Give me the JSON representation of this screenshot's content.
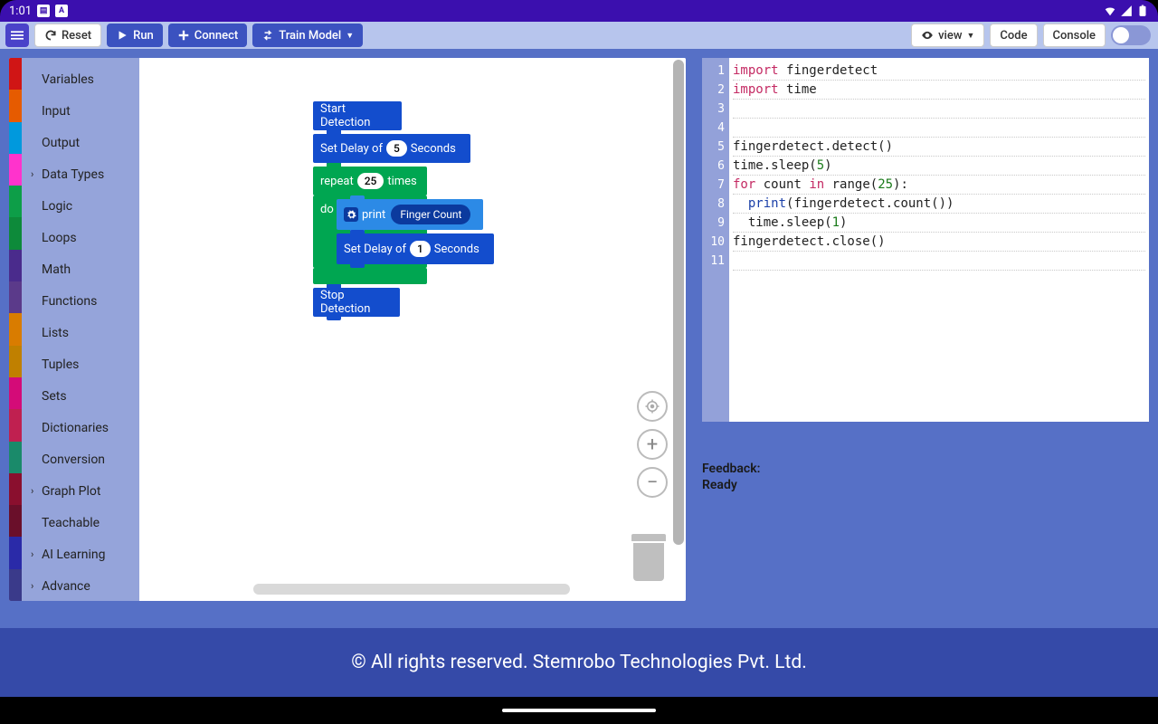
{
  "status": {
    "time": "1:01"
  },
  "toolbar": {
    "reset": "Reset",
    "run": "Run",
    "connect": "Connect",
    "train": "Train Model",
    "view": "view",
    "code": "Code",
    "console": "Console"
  },
  "categories": [
    {
      "label": "Variables",
      "expand": false,
      "color": "#d01515"
    },
    {
      "label": "Input",
      "expand": false,
      "color": "#e65b00"
    },
    {
      "label": "Output",
      "expand": false,
      "color": "#0099dd"
    },
    {
      "label": "Data Types",
      "expand": true,
      "color": "#ff33cc"
    },
    {
      "label": "Logic",
      "expand": false,
      "color": "#0d9e48"
    },
    {
      "label": "Loops",
      "expand": false,
      "color": "#0d8a3a"
    },
    {
      "label": "Math",
      "expand": false,
      "color": "#4a2b8c"
    },
    {
      "label": "Functions",
      "expand": false,
      "color": "#5b3a8a"
    },
    {
      "label": "Lists",
      "expand": false,
      "color": "#d97c00"
    },
    {
      "label": "Tuples",
      "expand": false,
      "color": "#c08000"
    },
    {
      "label": "Sets",
      "expand": false,
      "color": "#d40b78"
    },
    {
      "label": "Dictionaries",
      "expand": false,
      "color": "#c02050"
    },
    {
      "label": "Conversion",
      "expand": false,
      "color": "#1a8a6a"
    },
    {
      "label": "Graph Plot",
      "expand": true,
      "color": "#8a0f2e"
    },
    {
      "label": "Teachable",
      "expand": false,
      "color": "#6a0f2a"
    },
    {
      "label": "AI Learning",
      "expand": true,
      "color": "#2a2aa8"
    },
    {
      "label": "Advance",
      "expand": true,
      "color": "#3a3a8a"
    }
  ],
  "blocks": {
    "start": "Start Detection",
    "delay1_pre": "Set Delay of",
    "delay1_val": "5",
    "delay1_suf": "Seconds",
    "repeat_pre": "repeat",
    "repeat_val": "25",
    "repeat_suf": "times",
    "do": "do",
    "print": "print",
    "finger": "Finger Count",
    "delay2_pre": "Set Delay of",
    "delay2_val": "1",
    "delay2_suf": "Seconds",
    "stop": "Stop Detection"
  },
  "code_lines": [
    {
      "n": 1,
      "html": "<span class='kw'>import</span> fingerdetect"
    },
    {
      "n": 2,
      "html": "<span class='kw'>import</span> time"
    },
    {
      "n": 3,
      "html": ""
    },
    {
      "n": 4,
      "html": ""
    },
    {
      "n": 5,
      "html": "fingerdetect.detect()"
    },
    {
      "n": 6,
      "html": "time.sleep(<span class='num'>5</span>)"
    },
    {
      "n": 7,
      "html": "<span class='kw'>for</span> count <span class='kw'>in</span> range(<span class='num'>25</span>):"
    },
    {
      "n": 8,
      "html": "  <span class='fn'>print</span>(fingerdetect.count())"
    },
    {
      "n": 9,
      "html": "  time.sleep(<span class='num'>1</span>)"
    },
    {
      "n": 10,
      "html": "fingerdetect.close()"
    },
    {
      "n": 11,
      "html": ""
    }
  ],
  "feedback": {
    "label": "Feedback:",
    "status": "Ready"
  },
  "footer": "© All rights reserved. Stemrobo Technologies Pvt. Ltd."
}
